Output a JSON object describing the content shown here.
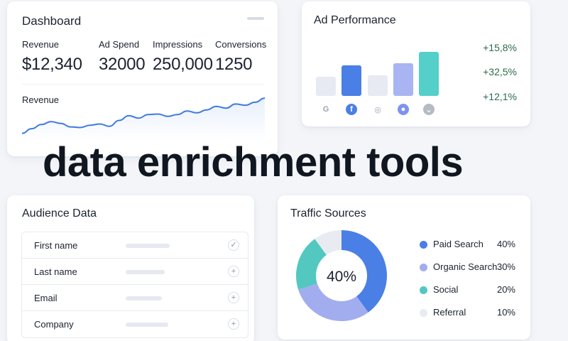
{
  "dashboard": {
    "title": "Dashboard",
    "metrics": [
      {
        "label": "Revenue",
        "value": "$12,340"
      },
      {
        "label": "Ad Spend",
        "value": "32000"
      },
      {
        "label": "Impressions",
        "value": "250,000"
      },
      {
        "label": "Conversions",
        "value": "1250"
      }
    ],
    "chart_label": "Revenue",
    "line_color": "#3f7ae0"
  },
  "ad_performance": {
    "title": "Ad Performance",
    "bars": [
      {
        "value": 0.38,
        "color": "#e7eaf3"
      },
      {
        "value": 0.62,
        "color": "#4a7fe6"
      },
      {
        "value": 0.42,
        "color": "#e7eaf3"
      },
      {
        "value": 0.66,
        "color": "#a9b4f2"
      },
      {
        "value": 0.88,
        "color": "#55cfca"
      }
    ],
    "platforms": [
      {
        "icon": "google-icon",
        "glyph": "G",
        "color": "#9aa3ae",
        "bg": "transparent"
      },
      {
        "icon": "facebook-icon",
        "glyph": "f",
        "color": "#ffffff",
        "bg": "#4a7fe6"
      },
      {
        "icon": "instagram-icon",
        "glyph": "◎",
        "color": "#9aa3ae",
        "bg": "transparent"
      },
      {
        "icon": "meta-icon",
        "glyph": "●",
        "color": "#ffffff",
        "bg": "#7f93ee"
      },
      {
        "icon": "message-icon",
        "glyph": "⌄",
        "color": "#ffffff",
        "bg": "#b5bbc4"
      }
    ],
    "changes": [
      "+15,8%",
      "+32,5%",
      "+12,1%"
    ]
  },
  "headline": "data enrichment tools",
  "audience": {
    "title": "Audience Data",
    "rows": [
      {
        "label": "First name",
        "action": "✓",
        "action_icon": "check-icon",
        "bar": 62
      },
      {
        "label": "Last name",
        "action": "+",
        "action_icon": "plus-icon",
        "bar": 55
      },
      {
        "label": "Email",
        "action": "+",
        "action_icon": "plus-icon",
        "bar": 51
      },
      {
        "label": "Company",
        "action": "+",
        "action_icon": "plus-icon",
        "bar": 60
      }
    ]
  },
  "traffic": {
    "title": "Traffic Sources",
    "center_label": "40%",
    "sources": [
      {
        "name": "Paid Search",
        "value": "40%",
        "share": 40,
        "color": "#4a7fe6"
      },
      {
        "name": "Organic Search",
        "value": "30%",
        "share": 30,
        "color": "#a2adf0"
      },
      {
        "name": "Social",
        "value": "20%",
        "share": 20,
        "color": "#52c8c0"
      },
      {
        "name": "Referral",
        "value": "10%",
        "share": 10,
        "color": "#e8ebf1"
      }
    ]
  },
  "chart_data": {
    "type": "line",
    "x": [
      0,
      1,
      2,
      3,
      4,
      5,
      6,
      7,
      8,
      9,
      10,
      11,
      12,
      13,
      14,
      15,
      16,
      17,
      18,
      19,
      20,
      21,
      22,
      23,
      24,
      25
    ],
    "values": [
      20,
      28,
      35,
      40,
      37,
      31,
      30,
      34,
      36,
      32,
      42,
      50,
      46,
      52,
      53,
      49,
      52,
      58,
      55,
      60,
      66,
      63,
      70,
      68,
      73,
      80
    ],
    "title": "",
    "xlabel": "",
    "ylabel": "Revenue"
  }
}
